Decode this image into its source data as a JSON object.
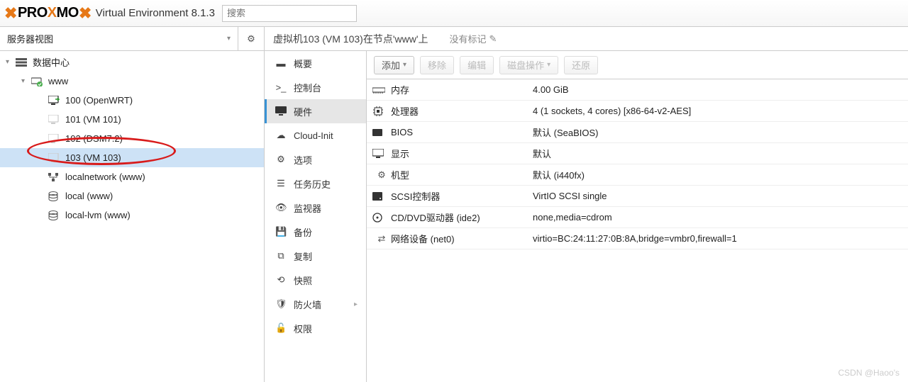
{
  "header": {
    "brand_pre": "PRO",
    "brand_mid_x": "X",
    "brand_post": "MO",
    "version_label": "Virtual Environment 8.1.3",
    "search_placeholder": "搜索"
  },
  "sidebar": {
    "view_label": "服务器视图",
    "tree": {
      "datacenter": "数据中心",
      "node": "www",
      "vms": [
        {
          "label": "100 (OpenWRT)"
        },
        {
          "label": "101 (VM 101)"
        },
        {
          "label": "102 (DSM7.2)"
        },
        {
          "label": "103 (VM 103)",
          "selected": true
        }
      ],
      "storages": [
        {
          "label": "localnetwork (www)"
        },
        {
          "label": "local (www)"
        },
        {
          "label": "local-lvm (www)"
        }
      ]
    }
  },
  "main": {
    "title": "虚拟机103 (VM 103)在节点'www'上",
    "no_tags": "没有标记"
  },
  "tabs": [
    {
      "icon": "book",
      "label": "概要"
    },
    {
      "icon": "terminal",
      "label": "控制台"
    },
    {
      "icon": "monitor",
      "label": "硬件",
      "active": true
    },
    {
      "icon": "cloud",
      "label": "Cloud-Init"
    },
    {
      "icon": "gear",
      "label": "选项"
    },
    {
      "icon": "list",
      "label": "任务历史"
    },
    {
      "icon": "eye",
      "label": "监视器"
    },
    {
      "icon": "save",
      "label": "备份"
    },
    {
      "icon": "copy",
      "label": "复制"
    },
    {
      "icon": "bolt",
      "label": "快照"
    },
    {
      "icon": "shield",
      "label": "防火墙",
      "arrow": true
    },
    {
      "icon": "lock",
      "label": "权限"
    }
  ],
  "toolbar": {
    "add": "添加",
    "remove": "移除",
    "edit": "编辑",
    "disk_action": "磁盘操作",
    "revert": "还原"
  },
  "hardware": [
    {
      "icon": "memory",
      "label": "内存",
      "value": "4.00 GiB"
    },
    {
      "icon": "cpu",
      "label": "处理器",
      "value": "4 (1 sockets, 4 cores) [x86-64-v2-AES]"
    },
    {
      "icon": "chip",
      "label": "BIOS",
      "value": "默认 (SeaBIOS)"
    },
    {
      "icon": "display",
      "label": "显示",
      "value": "默认"
    },
    {
      "icon": "cog",
      "label": "机型",
      "value": "默认 (i440fx)"
    },
    {
      "icon": "hdd",
      "label": "SCSI控制器",
      "value": "VirtIO SCSI single"
    },
    {
      "icon": "disc",
      "label": "CD/DVD驱动器 (ide2)",
      "value": "none,media=cdrom"
    },
    {
      "icon": "swap",
      "label": "网络设备 (net0)",
      "value": "virtio=BC:24:11:27:0B:8A,bridge=vmbr0,firewall=1"
    }
  ],
  "watermark": "CSDN @Haoo's"
}
